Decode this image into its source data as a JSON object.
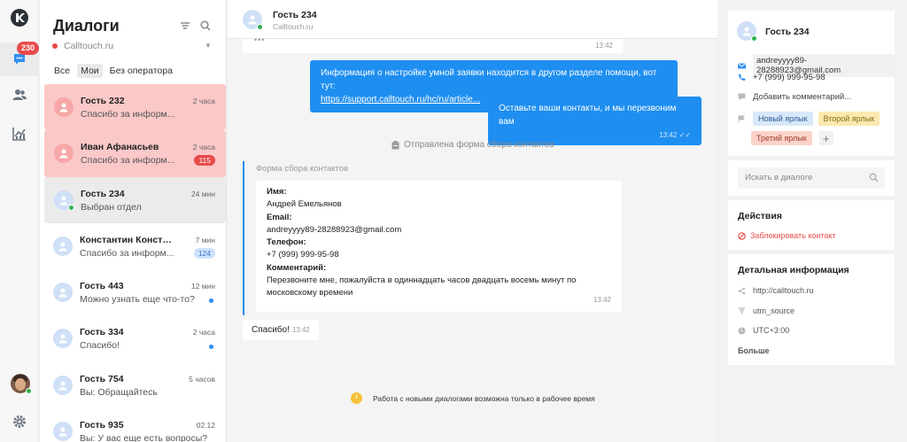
{
  "nav": {
    "unread_badge": "230"
  },
  "list": {
    "title": "Диалоги",
    "site": "Calltouch.ru",
    "tabs": [
      "Все",
      "Мои",
      "Без оператора"
    ],
    "items": [
      {
        "name": "Гость 232",
        "time": "2 часа",
        "message": "Спасибо за информ...",
        "count": ""
      },
      {
        "name": "Иван Афанасьев",
        "time": "2 часа",
        "message": "Спасибо за информ...",
        "count": "115"
      },
      {
        "name": "Гость 234",
        "time": "24 мин",
        "message": "Выбран отдел",
        "count": ""
      },
      {
        "name": "Константин Конста...",
        "time": "7 мин",
        "message": "Спасибо за информ...",
        "count": "124"
      },
      {
        "name": "Гость 443",
        "time": "12 мин",
        "message": "Можно узнать еще что-то?",
        "count": ""
      },
      {
        "name": "Гость 334",
        "time": "2 часа",
        "message": "Спасибо!",
        "count": ""
      },
      {
        "name": "Гость 754",
        "time": "5 часов",
        "message": "Вы: Обращайтесь",
        "count": ""
      },
      {
        "name": "Гость 935",
        "time": "02.12",
        "message": "Вы: У вас еще есть вопросы?",
        "count": ""
      }
    ]
  },
  "chat": {
    "name": "Гость 234",
    "site": "Calltouch.ru",
    "first_time": "13:42",
    "out1_text": "Информация о настройке умной заявки находится в другом разделе помощи, вот тут:",
    "out1_link": "https://support.calltouch.ru/hc/ru/article...",
    "out2_text": "Оставьте ваши контакты, и мы перезвоним вам",
    "out2_time": "13:42",
    "system_text": "Отправлена форма сбора контактов",
    "form_label": "Форма сбора контактов",
    "form": {
      "name_label": "Имя:",
      "name": "Андрей Емельянов",
      "email_label": "Email:",
      "email": "andreyyyy89-28288923@gmail.com",
      "phone_label": "Телефон:",
      "phone": "+7 (999) 999-95-98",
      "comment_label": "Комментарий:",
      "comment": "Перезвоните мне, пожалуйста в одиннадцать часов двадцать восемь минут по московскому времени",
      "time": "13:42"
    },
    "thanks": "Спасибо!",
    "thanks_time": "13:42",
    "notice": "Работа с новыми диалогами возможна только в рабочее время"
  },
  "contact": {
    "name": "Гость 234",
    "email": "andreyyyy89-28288923@gmail.com",
    "phone": "+7 (999) 999-95-98",
    "comment_placeholder": "Добавить комментарий...",
    "tags": [
      "Новый ярлык",
      "Второй ярлык",
      "Третий ярлык"
    ],
    "tag_colors": [
      "#d8e8fa",
      "#fbe9b0",
      "#fcd3c9"
    ]
  },
  "search": {
    "placeholder": "Искать в диалоге"
  },
  "actions": {
    "title": "Действия",
    "block": "Заблокировать контакт"
  },
  "details": {
    "title": "Детальная информация",
    "url": "http://calltouch.ru",
    "utm": "utm_source",
    "tz": "UTC+3:00",
    "more": "Больше"
  }
}
